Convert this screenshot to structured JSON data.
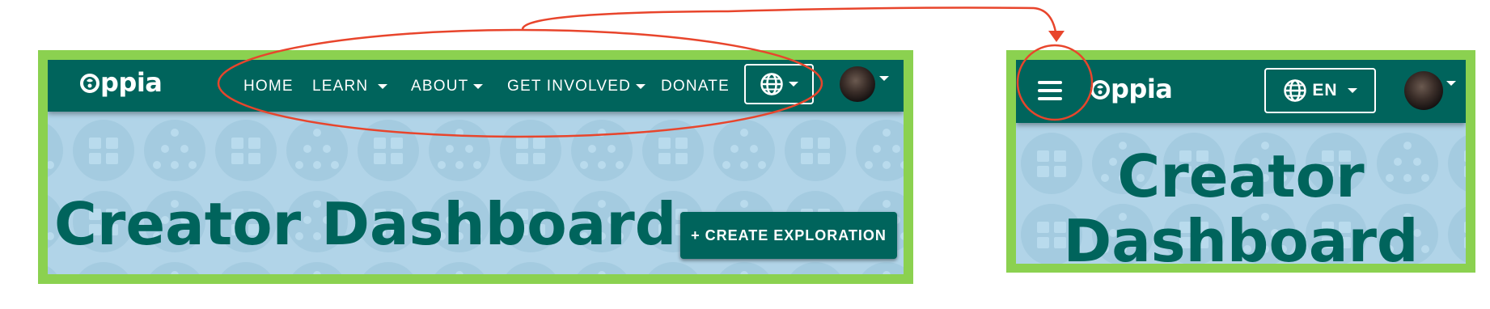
{
  "desktop": {
    "logo_text": "ppia",
    "nav_items": [
      {
        "label": "HOME",
        "has_dropdown": false
      },
      {
        "label": "LEARN",
        "has_dropdown": true
      },
      {
        "label": "ABOUT",
        "has_dropdown": true
      },
      {
        "label": "GET INVOLVED",
        "has_dropdown": true
      },
      {
        "label": "DONATE",
        "has_dropdown": false
      }
    ],
    "language_icon": "globe-icon",
    "page_title": "Creator Dashboard",
    "create_button_label": "+ CREATE EXPLORATION"
  },
  "mobile": {
    "logo_text": "ppia",
    "menu_icon": "hamburger-menu-icon",
    "language_icon": "globe-icon",
    "language_label": "EN",
    "page_title_line1": "Creator",
    "page_title_line2": "Dashboard"
  },
  "colors": {
    "brand": "#00645c",
    "frame": "#8bd150",
    "hero_background": "#b1d4e8",
    "annotation": "#e8452c"
  }
}
